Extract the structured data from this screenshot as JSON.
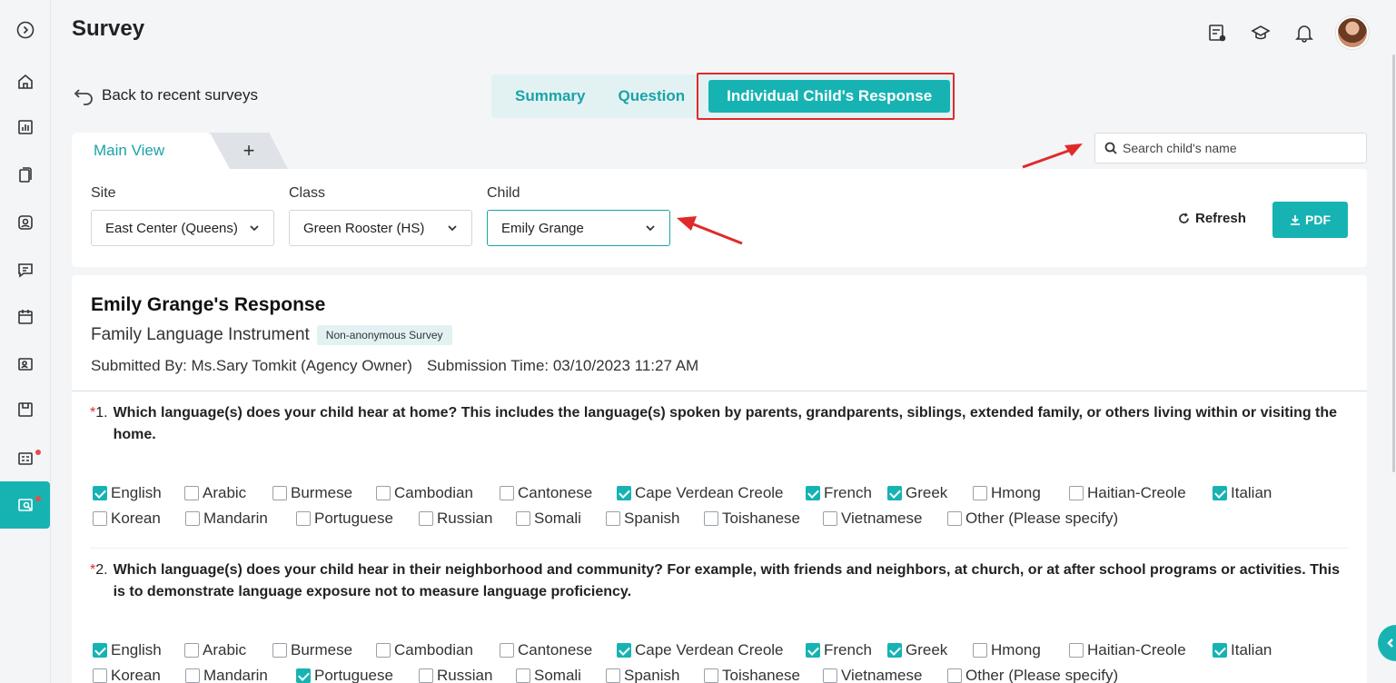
{
  "app": {
    "title": "Survey"
  },
  "header": {
    "icons": [
      "document-user-icon",
      "graduation-cap-icon",
      "bell-icon",
      "avatar"
    ]
  },
  "nav": {
    "back_label": "Back to recent surveys",
    "tabs": [
      {
        "label": "Summary",
        "active": false
      },
      {
        "label": "Question",
        "active": false
      },
      {
        "label": "Individual Child's Response",
        "active": true
      }
    ]
  },
  "views": {
    "main_label": "Main View",
    "add_label": "+"
  },
  "search": {
    "placeholder": "Search child's name"
  },
  "filters": {
    "site": {
      "label": "Site",
      "value": "East Center (Queens)"
    },
    "class": {
      "label": "Class",
      "value": "Green Rooster (HS)"
    },
    "child": {
      "label": "Child",
      "value": "Emily Grange"
    }
  },
  "actions": {
    "refresh_label": "Refresh",
    "pdf_label": "PDF"
  },
  "response": {
    "title": "Emily Grange's Response",
    "survey_name": "Family Language Instrument",
    "badge": "Non-anonymous Survey",
    "submitted_by": "Submitted By: Ms.Sary Tomkit (Agency Owner)",
    "submission_time": "Submission Time: 03/10/2023 11:27 AM"
  },
  "questions": [
    {
      "number": "1.",
      "text": "Which language(s) does your child hear at home? This includes the language(s) spoken by parents, grandparents, siblings, extended family, or others living within or visiting the home.",
      "rows": [
        [
          {
            "label": "English",
            "checked": true
          },
          {
            "label": "Arabic",
            "checked": false
          },
          {
            "label": "Burmese",
            "checked": false
          },
          {
            "label": "Cambodian",
            "checked": false
          },
          {
            "label": "Cantonese",
            "checked": false
          },
          {
            "label": "Cape Verdean Creole",
            "checked": true
          },
          {
            "label": "French",
            "checked": true
          },
          {
            "label": "Greek",
            "checked": true
          },
          {
            "label": "Hmong",
            "checked": false
          },
          {
            "label": "Haitian-Creole",
            "checked": false
          },
          {
            "label": "Italian",
            "checked": true
          }
        ],
        [
          {
            "label": "Korean",
            "checked": false
          },
          {
            "label": "Mandarin",
            "checked": false
          },
          {
            "label": "Portuguese",
            "checked": false
          },
          {
            "label": "Russian",
            "checked": false
          },
          {
            "label": "Somali",
            "checked": false
          },
          {
            "label": "Spanish",
            "checked": false
          },
          {
            "label": "Toishanese",
            "checked": false
          },
          {
            "label": "Vietnamese",
            "checked": false
          },
          {
            "label": "Other (Please specify)",
            "checked": false
          }
        ]
      ]
    },
    {
      "number": "2.",
      "text": "Which language(s) does your child hear in their neighborhood and community? For example, with friends and neighbors, at church, or at after school programs or activities. This is to demonstrate language exposure not to measure language proficiency.",
      "rows": [
        [
          {
            "label": "English",
            "checked": true
          },
          {
            "label": "Arabic",
            "checked": false
          },
          {
            "label": "Burmese",
            "checked": false
          },
          {
            "label": "Cambodian",
            "checked": false
          },
          {
            "label": "Cantonese",
            "checked": false
          },
          {
            "label": "Cape Verdean Creole",
            "checked": true
          },
          {
            "label": "French",
            "checked": true
          },
          {
            "label": "Greek",
            "checked": true
          },
          {
            "label": "Hmong",
            "checked": false
          },
          {
            "label": "Haitian-Creole",
            "checked": false
          },
          {
            "label": "Italian",
            "checked": true
          }
        ],
        [
          {
            "label": "Korean",
            "checked": false
          },
          {
            "label": "Mandarin",
            "checked": false
          },
          {
            "label": "Portuguese",
            "checked": true
          },
          {
            "label": "Russian",
            "checked": false
          },
          {
            "label": "Somali",
            "checked": false
          },
          {
            "label": "Spanish",
            "checked": false
          },
          {
            "label": "Toishanese",
            "checked": false
          },
          {
            "label": "Vietnamese",
            "checked": false
          },
          {
            "label": "Other (Please specify)",
            "checked": false
          }
        ]
      ]
    }
  ],
  "colors": {
    "accent": "#17b3b3",
    "accent_text": "#1aa3a8",
    "annotation": "#e02a2a",
    "tab_bg": "#e2f2f3"
  }
}
